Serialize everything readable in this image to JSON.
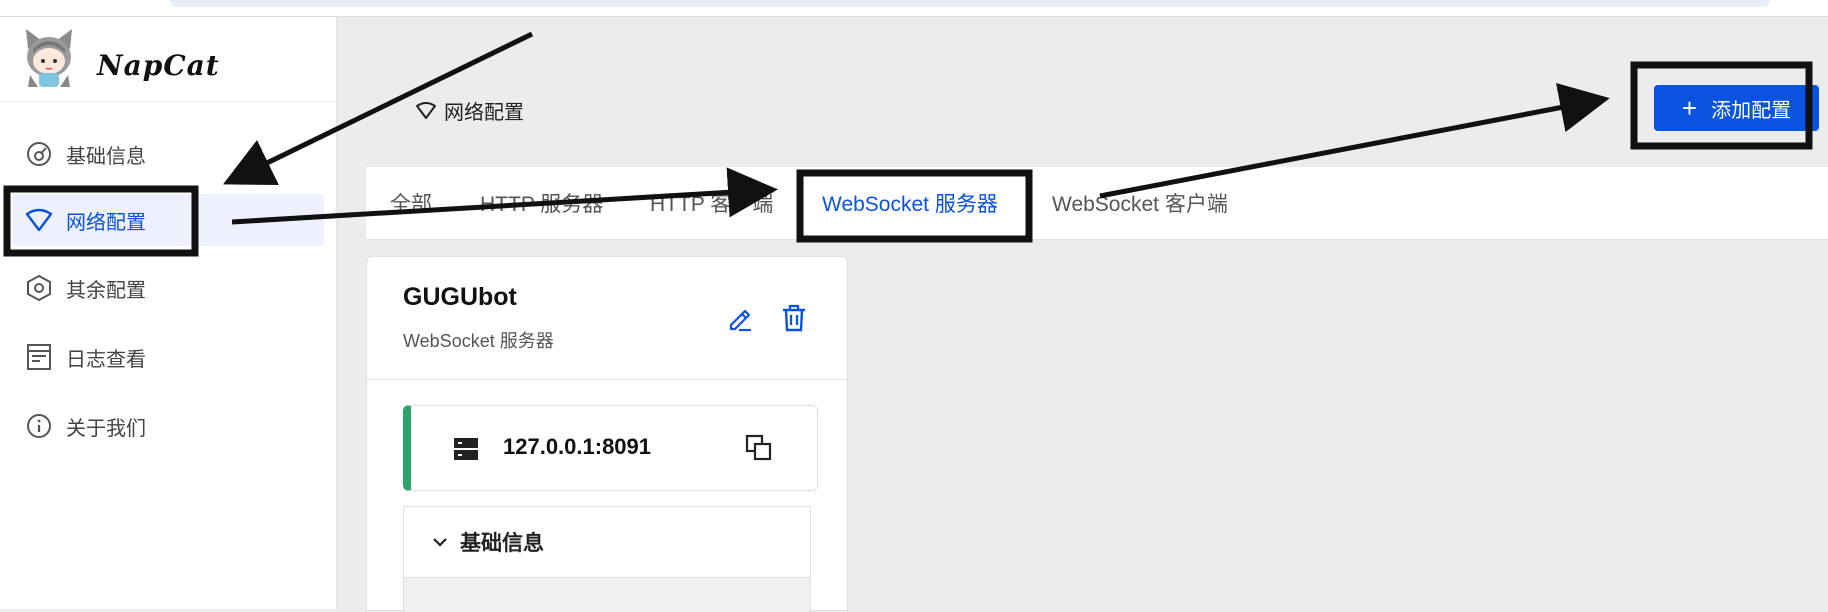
{
  "brand": {
    "name": "NapCat"
  },
  "sidebar": {
    "items": [
      {
        "label": "基础信息",
        "icon": "dashboard-icon",
        "active": false
      },
      {
        "label": "网络配置",
        "icon": "wifi-icon",
        "active": true
      },
      {
        "label": "其余配置",
        "icon": "hexagon-settings-icon",
        "active": false
      },
      {
        "label": "日志查看",
        "icon": "log-icon",
        "active": false
      },
      {
        "label": "关于我们",
        "icon": "info-icon",
        "active": false
      }
    ]
  },
  "header": {
    "title": "网络配置",
    "add_button": "添加配置"
  },
  "tabs": [
    {
      "label": "全部",
      "active": false
    },
    {
      "label": "HTTP 服务器",
      "active": false
    },
    {
      "label": "HTTP 客户端",
      "active": false
    },
    {
      "label": "WebSocket 服务器",
      "active": true
    },
    {
      "label": "WebSocket 客户端",
      "active": false
    }
  ],
  "card": {
    "title": "GUGUbot",
    "subtitle": "WebSocket 服务器",
    "address": "127.0.0.1:8091",
    "section_label": "基础信息"
  },
  "colors": {
    "accent": "#0a52e0",
    "active_bg": "#eef1fd",
    "status_bar": "#2ba36b"
  }
}
